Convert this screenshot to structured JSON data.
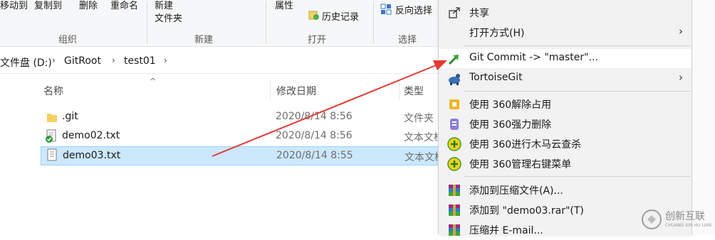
{
  "ribbon": {
    "move_to": "移动到",
    "copy_to": "复制到",
    "delete": "删除",
    "rename": "重命名",
    "new_label_1": "新建",
    "new_label_2": "文件夹",
    "properties": "属性",
    "history": "历史记录",
    "invert_select": "反向选择",
    "groups": {
      "organize": "组织",
      "new": "新建",
      "open": "打开",
      "select": "选择"
    }
  },
  "address": {
    "crumbs": [
      "文件盘 (D:)",
      "GitRoot",
      "test01"
    ]
  },
  "columns": {
    "name": "名称",
    "date": "修改日期",
    "type": "类型"
  },
  "files": [
    {
      "name": ".git",
      "date": "2020/8/14 8:56",
      "type": "文件夹"
    },
    {
      "name": "demo02.txt",
      "date": "2020/8/14 8:56",
      "type": "文本文档"
    },
    {
      "name": "demo03.txt",
      "date": "2020/8/14 8:55",
      "type": "文本文档"
    }
  ],
  "menu": {
    "share": "共享",
    "open_with": "打开方式(H)",
    "git_commit": "Git Commit -> \"master\"...",
    "tortoisegit": "TortoiseGit",
    "unlock_360": "使用 360解除占用",
    "force_delete_360": "使用 360强力删除",
    "scan_360": "使用 360进行木马云查杀",
    "manage_menu_360": "使用 360管理右键菜单",
    "add_archive": "添加到压缩文件(A)...",
    "add_rar": "添加到 \"demo03.rar\"(T)",
    "compress_email": "压缩并 E-mail..."
  },
  "watermark": {
    "name": "创新互联",
    "sub": "CHUANG XIN HU LIAN"
  },
  "colors": {
    "selection": "#cce8ff",
    "arrow": "#e53935",
    "menu_bg": "#f2f2f2"
  }
}
